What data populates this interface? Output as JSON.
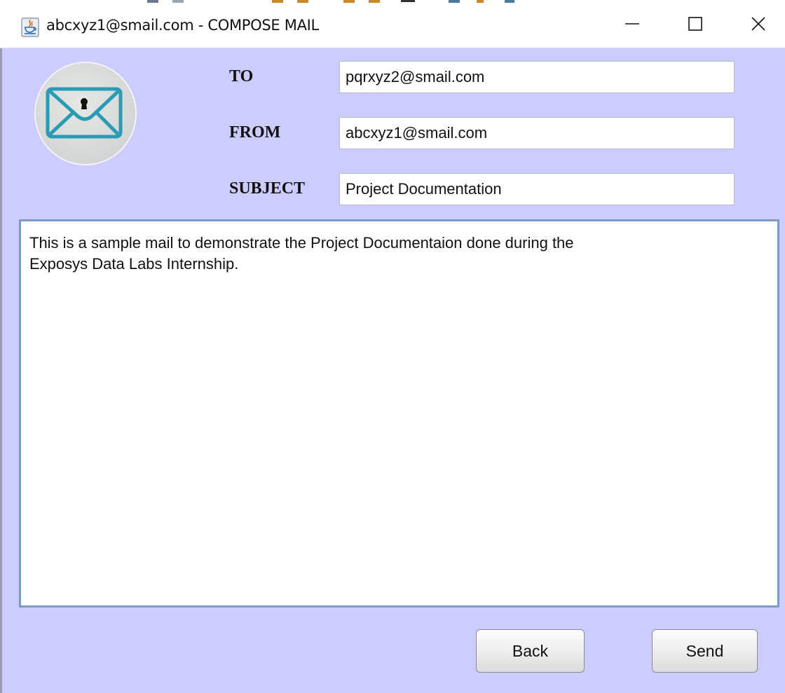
{
  "window": {
    "title": "abcxyz1@smail.com - COMPOSE MAIL",
    "app_icon": "java-icon",
    "controls": {
      "minimize": "minimize-icon",
      "maximize": "maximize-icon",
      "close": "close-icon"
    }
  },
  "logo": {
    "icon": "locked-envelope-icon"
  },
  "form": {
    "to_label": "TO",
    "to_value": "pqrxyz2@smail.com",
    "from_label": "FROM",
    "from_value": "abcxyz1@smail.com",
    "subject_label": "SUBJECT",
    "subject_value": "Project Documentation"
  },
  "message": {
    "body": "This is a sample mail to demonstrate the Project Documentaion done during the\nExposys Data Labs Internship."
  },
  "buttons": {
    "back_label": "Back",
    "send_label": "Send"
  },
  "colors": {
    "background": "#ccccff",
    "body_border": "#7a9cc8",
    "envelope": "#2a9bb4"
  }
}
